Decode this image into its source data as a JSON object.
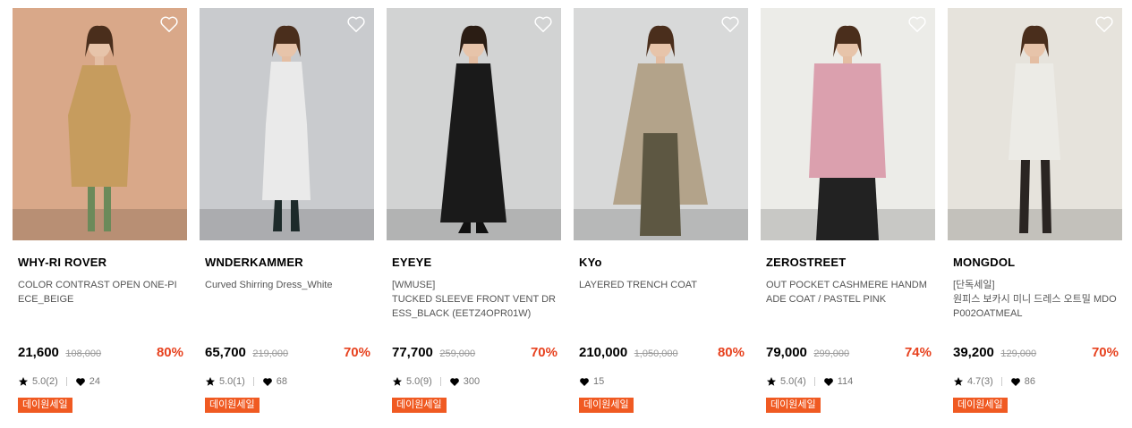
{
  "products": [
    {
      "brand": "WHY-RI ROVER",
      "tag": "",
      "name": "COLOR CONTRAST OPEN ONE-PIECE_BEIGE",
      "price": "21,600",
      "original_price": "108,000",
      "discount": "80%",
      "rating": "5.0(2)",
      "likes": "24",
      "badge": "데이원세일",
      "colors": {
        "bg": "#d9a889",
        "garment": "#c69c5e",
        "accent": "#6b8a5a"
      }
    },
    {
      "brand": "WNDERKAMMER",
      "tag": "",
      "name": "Curved Shirring Dress_White",
      "price": "65,700",
      "original_price": "219,000",
      "discount": "70%",
      "rating": "5.0(1)",
      "likes": "68",
      "badge": "데이원세일",
      "colors": {
        "bg": "#c9cbce",
        "garment": "#eaeaea",
        "accent": "#1d2a2a"
      }
    },
    {
      "brand": "EYEYE",
      "tag": "[WMUSE]",
      "name": "TUCKED SLEEVE FRONT VENT DRESS_BLACK (EETZ4OPR01W)",
      "price": "77,700",
      "original_price": "259,000",
      "discount": "70%",
      "rating": "5.0(9)",
      "likes": "300",
      "badge": "데이원세일",
      "colors": {
        "bg": "#d2d3d3",
        "garment": "#1a1a1a",
        "accent": "#111111"
      }
    },
    {
      "brand": "KYo",
      "tag": "",
      "name": "LAYERED TRENCH COAT",
      "price": "210,000",
      "original_price": "1,050,000",
      "discount": "80%",
      "rating": "",
      "likes": "15",
      "badge": "데이원세일",
      "colors": {
        "bg": "#d8d9d9",
        "garment": "#b3a38a",
        "accent": "#5d5742"
      }
    },
    {
      "brand": "ZEROSTREET",
      "tag": "",
      "name": "OUT POCKET CASHMERE HANDMADE COAT / PASTEL PINK",
      "price": "79,000",
      "original_price": "299,000",
      "discount": "74%",
      "rating": "5.0(4)",
      "likes": "114",
      "badge": "데이원세일",
      "colors": {
        "bg": "#ecece8",
        "garment": "#dba0ae",
        "accent": "#222222"
      }
    },
    {
      "brand": "MONGDOL",
      "tag": "[단독세일]",
      "name": "원피스 보카시 미니 드레스 오트밀 MDOP002OATMEAL",
      "price": "39,200",
      "original_price": "129,000",
      "discount": "70%",
      "rating": "4.7(3)",
      "likes": "86",
      "badge": "데이원세일",
      "colors": {
        "bg": "#e6e3dc",
        "garment": "#ecebe6",
        "accent": "#2a2522"
      }
    }
  ],
  "icons": {
    "wishlist": "heart-outline-icon",
    "rating": "star-icon",
    "likes": "heart-icon"
  },
  "accent_color": "#e7421f",
  "badge_color": "#f05a22"
}
